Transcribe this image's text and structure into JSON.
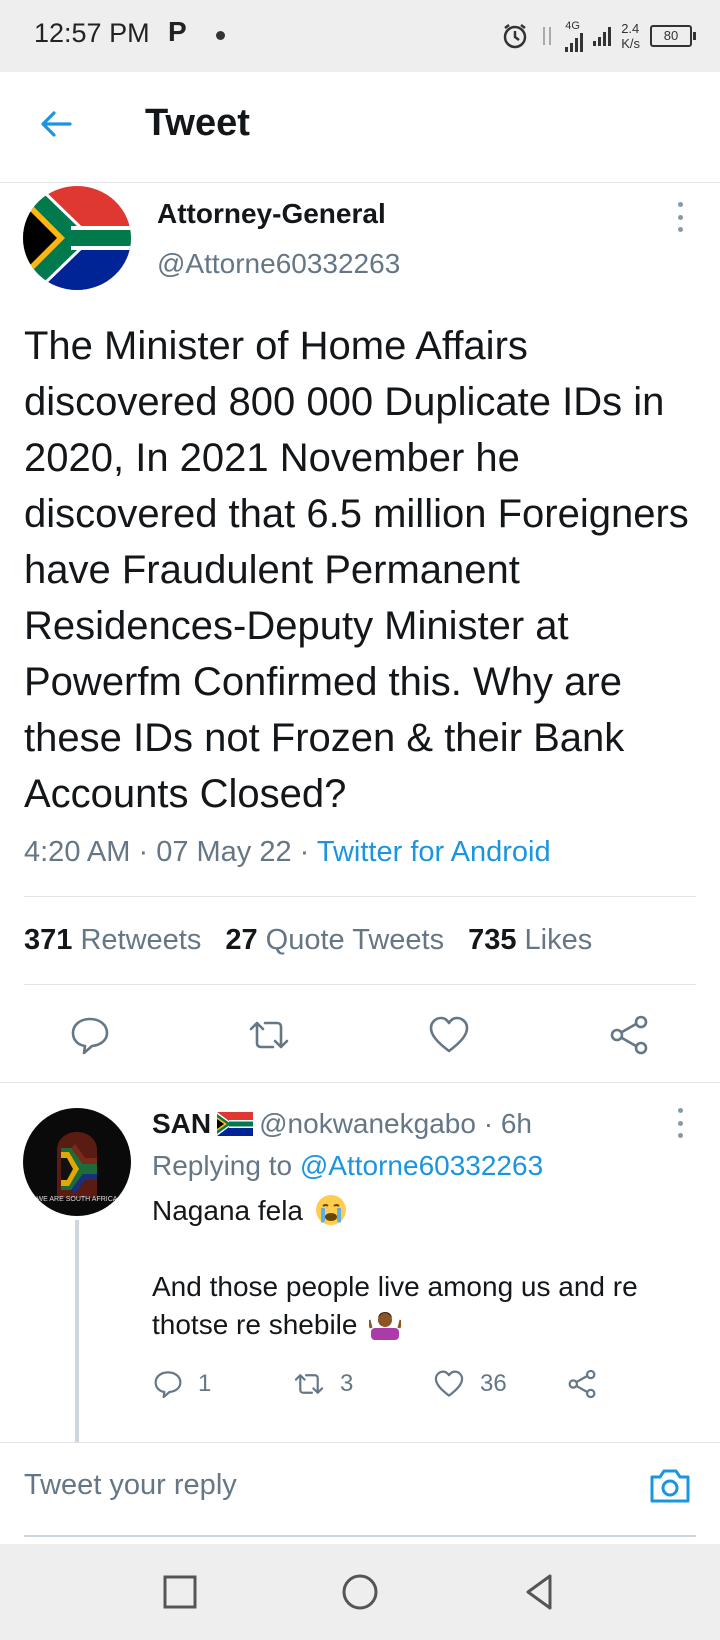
{
  "status_bar": {
    "time": "12:57 PM",
    "p_icon": "P",
    "network": "4G",
    "speed_value": "2.4",
    "speed_unit": "K/s",
    "battery": "80"
  },
  "header": {
    "title": "Tweet"
  },
  "tweet": {
    "author_name": "Attorney-General",
    "author_handle": "@Attorne60332263",
    "text": "The Minister of Home Affairs discovered 800 000 Duplicate IDs in 2020, In 2021 November he discovered that 6.5 million Foreigners have Fraudulent Permanent Residences-Deputy Minister at Powerfm Confirmed this. Why are these IDs not Frozen & their Bank Accounts Closed?",
    "time": "4:20 AM",
    "date": "07 May 22",
    "source": "Twitter for Android",
    "stats": {
      "retweets_count": "371",
      "retweets_label": "Retweets",
      "quotes_count": "27",
      "quotes_label": "Quote Tweets",
      "likes_count": "735",
      "likes_label": "Likes"
    }
  },
  "reply": {
    "author_name": "SAN",
    "author_handle": "@nokwanekgabo",
    "age": "6h",
    "replying_prefix": "Replying to",
    "replying_to": "@Attorne60332263",
    "avatar_text": "WE ARE SOUTH AFRICA",
    "line1": "Nagana fela",
    "line2": "And those people live among us and re thotse re shebile",
    "replies": "1",
    "retweets": "3",
    "likes": "36"
  },
  "composer": {
    "placeholder": "Tweet your reply"
  },
  "colors": {
    "accent": "#1b95e0",
    "secondary_text": "#657786",
    "primary_text": "#14171a"
  }
}
